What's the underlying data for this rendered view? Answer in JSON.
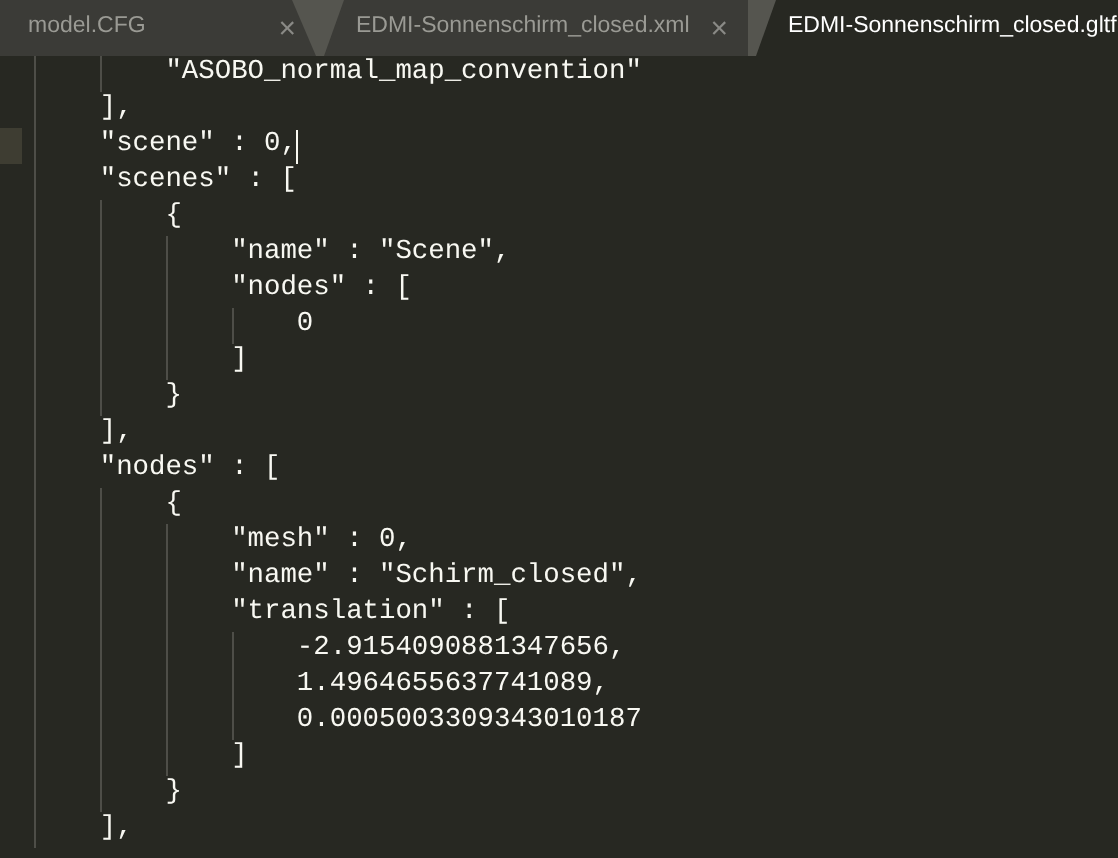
{
  "tabs": [
    {
      "label": "model.CFG",
      "close": "×",
      "selected": false
    },
    {
      "label": "EDMI-Sonnenschirm_closed.xml",
      "close": "×",
      "selected": false
    },
    {
      "label": "EDMI-Sonnenschirm_closed.gltf",
      "selected": true
    }
  ],
  "editor": {
    "lines": [
      {
        "text": "        \"ASOBO_normal_map_convention\"",
        "current": false
      },
      {
        "text": "    ],",
        "current": false
      },
      {
        "text": "    \"scene\" : 0,",
        "current": true
      },
      {
        "text": "    \"scenes\" : [",
        "current": false
      },
      {
        "text": "        {",
        "current": false
      },
      {
        "text": "            \"name\" : \"Scene\",",
        "current": false
      },
      {
        "text": "            \"nodes\" : [",
        "current": false
      },
      {
        "text": "                0",
        "current": false
      },
      {
        "text": "            ]",
        "current": false
      },
      {
        "text": "        }",
        "current": false
      },
      {
        "text": "    ],",
        "current": false
      },
      {
        "text": "    \"nodes\" : [",
        "current": false
      },
      {
        "text": "        {",
        "current": false
      },
      {
        "text": "            \"mesh\" : 0,",
        "current": false
      },
      {
        "text": "            \"name\" : \"Schirm_closed\",",
        "current": false
      },
      {
        "text": "            \"translation\" : [",
        "current": false
      },
      {
        "text": "                -2.9154090881347656,",
        "current": false
      },
      {
        "text": "                1.4964655637741089,",
        "current": false
      },
      {
        "text": "                0.0005003309343010187",
        "current": false
      },
      {
        "text": "            ]",
        "current": false
      },
      {
        "text": "        }",
        "current": false
      },
      {
        "text": "    ],",
        "current": false
      }
    ]
  }
}
